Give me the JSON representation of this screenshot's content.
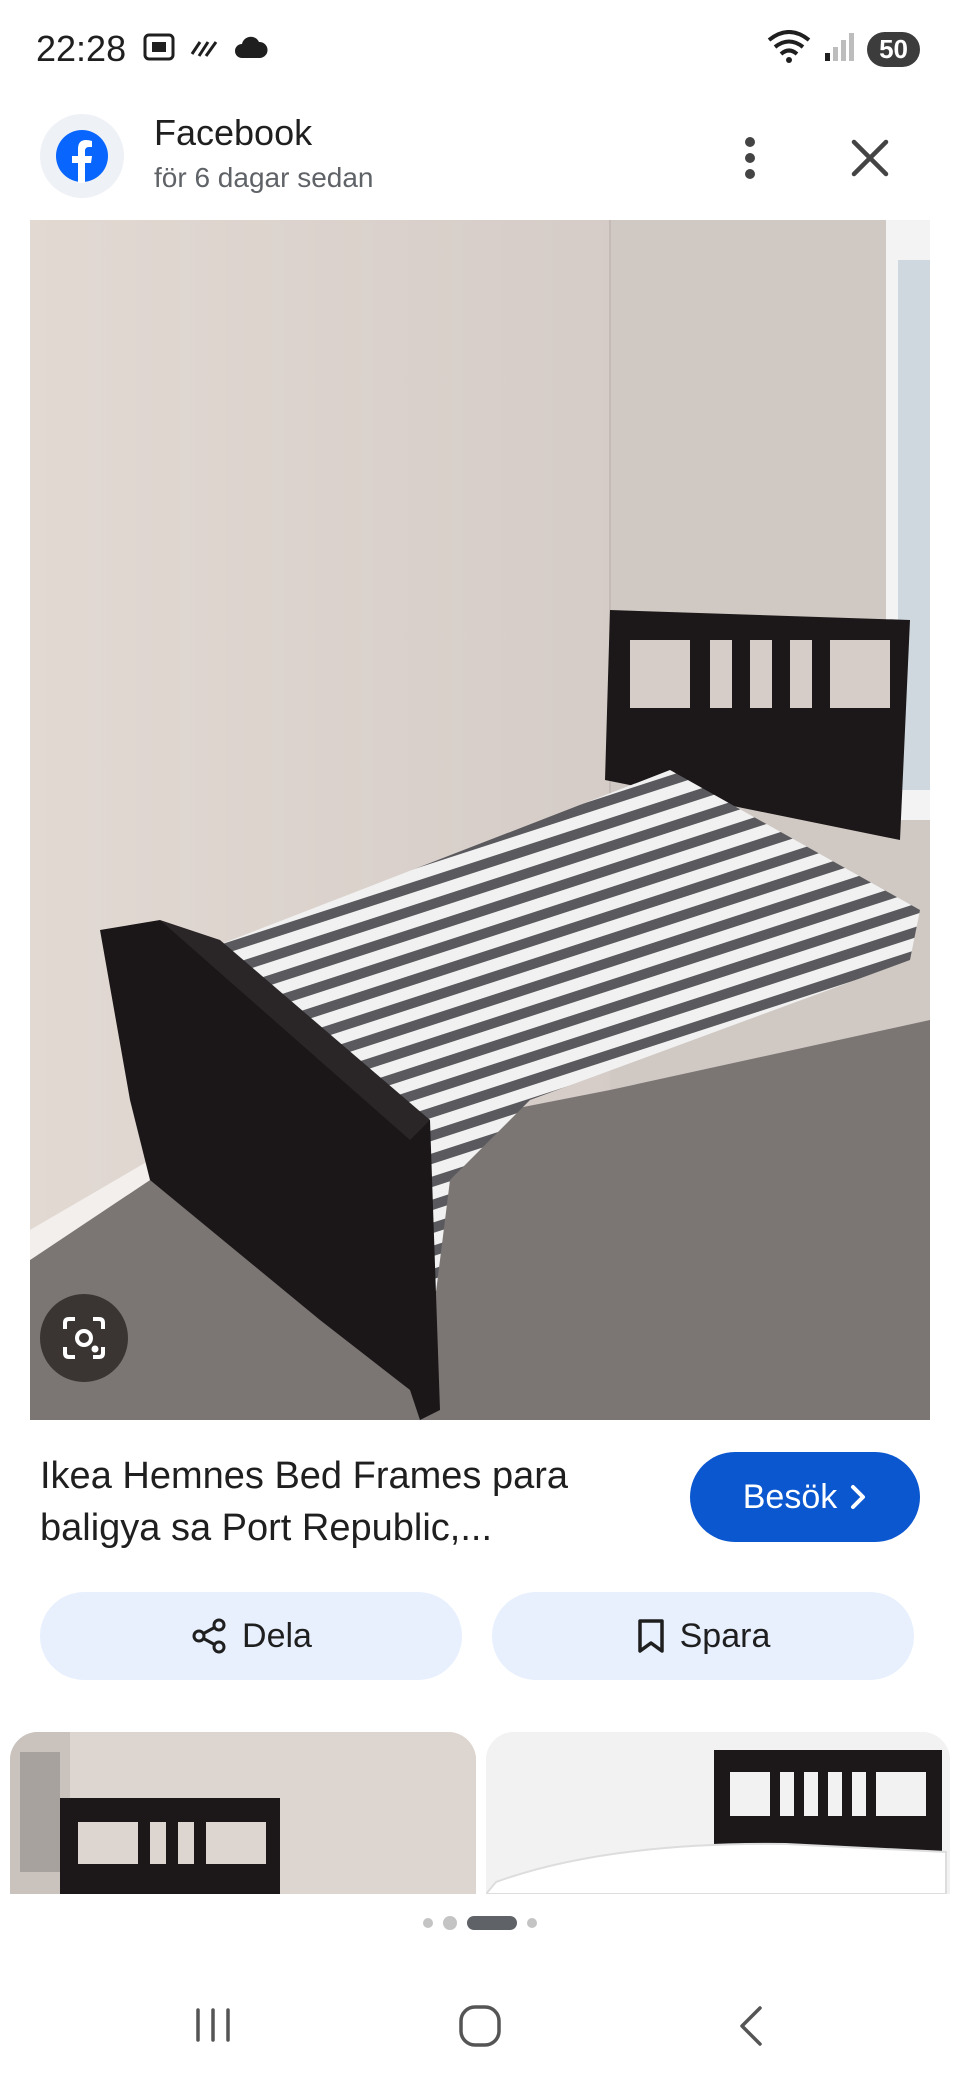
{
  "status_bar": {
    "time": "22:28",
    "battery": "50",
    "left_icons": [
      "screenshot-icon",
      "signal-lines-icon",
      "cloud-icon"
    ],
    "right_icons": [
      "wifi-icon",
      "cell-signal-icon",
      "battery-icon"
    ]
  },
  "header": {
    "source_name": "Facebook",
    "posted": "för 6 dagar sedan"
  },
  "result": {
    "title": "Ikea Hemnes Bed Frames para baligya sa Port Republic,...",
    "visit_label": "Besök"
  },
  "actions": {
    "share_label": "Dela",
    "save_label": "Spara"
  },
  "pager": {
    "page_count": 4,
    "active_index": 2
  },
  "colors": {
    "accent": "#0b57d0",
    "pill_bg": "#e8f0fe",
    "facebook_blue": "#0866ff"
  }
}
